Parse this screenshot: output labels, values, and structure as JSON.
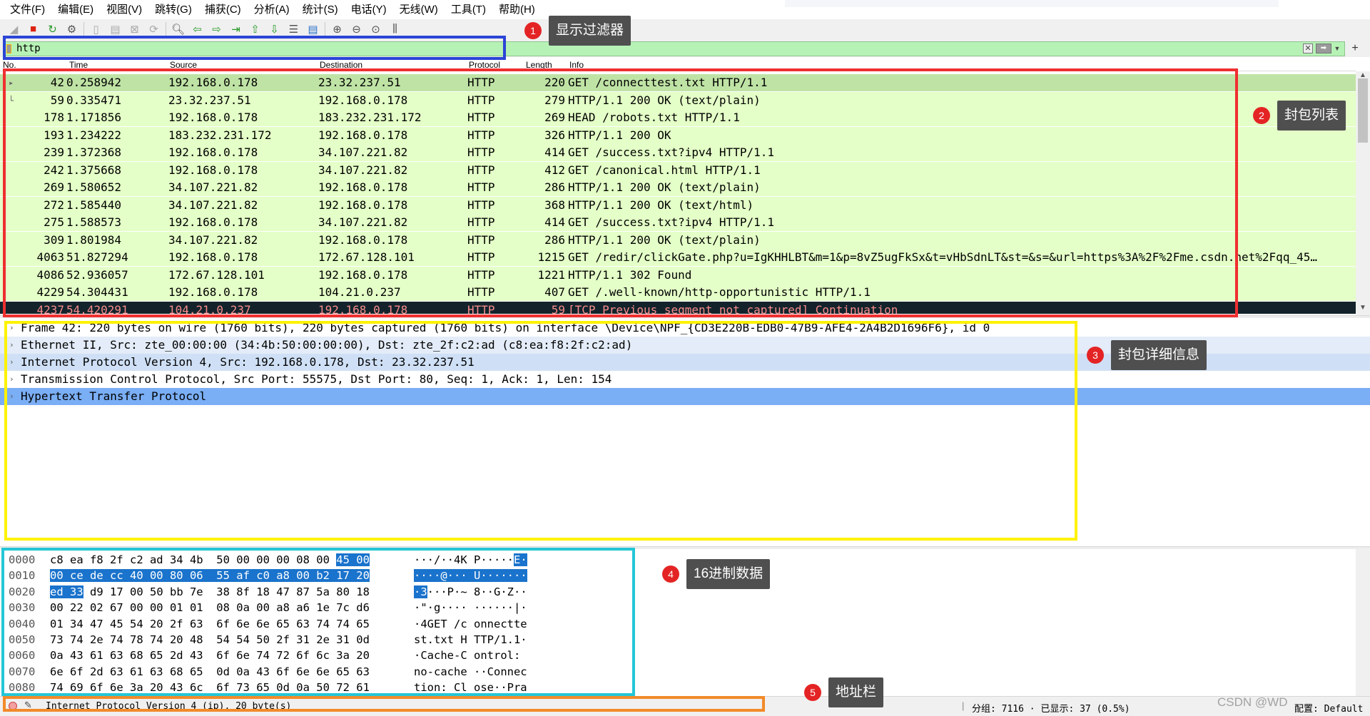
{
  "menu": [
    "文件(F)",
    "编辑(E)",
    "视图(V)",
    "跳转(G)",
    "捕获(C)",
    "分析(A)",
    "统计(S)",
    "电话(Y)",
    "无线(W)",
    "工具(T)",
    "帮助(H)"
  ],
  "filter": {
    "value": "http"
  },
  "packet_list": {
    "columns": [
      "No.",
      "Time",
      "Source",
      "Destination",
      "Protocol",
      "Length",
      "Info"
    ],
    "rows": [
      {
        "no": "42",
        "time": "0.258942",
        "src": "192.168.0.178",
        "dst": "23.32.237.51",
        "proto": "HTTP",
        "len": "220",
        "info": "GET /connecttest.txt HTTP/1.1"
      },
      {
        "no": "59",
        "time": "0.335471",
        "src": "23.32.237.51",
        "dst": "192.168.0.178",
        "proto": "HTTP",
        "len": "279",
        "info": "HTTP/1.1 200 OK  (text/plain)"
      },
      {
        "no": "178",
        "time": "1.171856",
        "src": "192.168.0.178",
        "dst": "183.232.231.172",
        "proto": "HTTP",
        "len": "269",
        "info": "HEAD /robots.txt HTTP/1.1"
      },
      {
        "no": "193",
        "time": "1.234222",
        "src": "183.232.231.172",
        "dst": "192.168.0.178",
        "proto": "HTTP",
        "len": "326",
        "info": "HTTP/1.1 200 OK"
      },
      {
        "no": "239",
        "time": "1.372368",
        "src": "192.168.0.178",
        "dst": "34.107.221.82",
        "proto": "HTTP",
        "len": "414",
        "info": "GET /success.txt?ipv4 HTTP/1.1"
      },
      {
        "no": "242",
        "time": "1.375668",
        "src": "192.168.0.178",
        "dst": "34.107.221.82",
        "proto": "HTTP",
        "len": "412",
        "info": "GET /canonical.html HTTP/1.1"
      },
      {
        "no": "269",
        "time": "1.580652",
        "src": "34.107.221.82",
        "dst": "192.168.0.178",
        "proto": "HTTP",
        "len": "286",
        "info": "HTTP/1.1 200 OK  (text/plain)"
      },
      {
        "no": "272",
        "time": "1.585440",
        "src": "34.107.221.82",
        "dst": "192.168.0.178",
        "proto": "HTTP",
        "len": "368",
        "info": "HTTP/1.1 200 OK  (text/html)"
      },
      {
        "no": "275",
        "time": "1.588573",
        "src": "192.168.0.178",
        "dst": "34.107.221.82",
        "proto": "HTTP",
        "len": "414",
        "info": "GET /success.txt?ipv4 HTTP/1.1"
      },
      {
        "no": "309",
        "time": "1.801984",
        "src": "34.107.221.82",
        "dst": "192.168.0.178",
        "proto": "HTTP",
        "len": "286",
        "info": "HTTP/1.1 200 OK  (text/plain)"
      },
      {
        "no": "4063",
        "time": "51.827294",
        "src": "192.168.0.178",
        "dst": "172.67.128.101",
        "proto": "HTTP",
        "len": "1215",
        "info": "GET /redir/clickGate.php?u=IgKHHLBT&m=1&p=8vZ5ugFkSx&t=vHbSdnLT&st=&s=&url=https%3A%2F%2Fme.csdn.net%2Fqq_45…"
      },
      {
        "no": "4086",
        "time": "52.936057",
        "src": "172.67.128.101",
        "dst": "192.168.0.178",
        "proto": "HTTP",
        "len": "1221",
        "info": "HTTP/1.1 302 Found"
      },
      {
        "no": "4229",
        "time": "54.304431",
        "src": "192.168.0.178",
        "dst": "104.21.0.237",
        "proto": "HTTP",
        "len": "407",
        "info": "GET /.well-known/http-opportunistic HTTP/1.1"
      },
      {
        "no": "4237",
        "time": "54.420291",
        "src": "104.21.0.237",
        "dst": "192.168.0.178",
        "proto": "HTTP",
        "len": "59",
        "info": "[TCP Previous segment not captured] Continuation"
      }
    ]
  },
  "details": [
    "Frame 42: 220 bytes on wire (1760 bits), 220 bytes captured (1760 bits) on interface \\Device\\NPF_{CD3E220B-EDB0-47B9-AFE4-2A4B2D1696F6}, id 0",
    "Ethernet II, Src: zte_00:00:00 (34:4b:50:00:00:00), Dst: zte_2f:c2:ad (c8:ea:f8:2f:c2:ad)",
    "Internet Protocol Version 4, Src: 192.168.0.178, Dst: 23.32.237.51",
    "Transmission Control Protocol, Src Port: 55575, Dst Port: 80, Seq: 1, Ack: 1, Len: 154",
    "Hypertext Transfer Protocol"
  ],
  "hex": [
    {
      "off": "0000",
      "hex_a": "c8 ea f8 2f c2 ad 34 4b  50 00 00 00 08 00 ",
      "hex_b": "45 00",
      "hex_c": "",
      "asc_a": "···/··4K P·····",
      "asc_b": "E·",
      "asc_c": ""
    },
    {
      "off": "0010",
      "hex_a": "",
      "hex_b": "00 ce de cc 40 00 80 06  55 af c0 a8 00 b2 17 20",
      "hex_c": "",
      "asc_a": "",
      "asc_b": "····@··· U·······",
      "asc_c": ""
    },
    {
      "off": "0020",
      "hex_a": "",
      "hex_b": "ed 33",
      "hex_c": " d9 17 00 50 bb 7e  38 8f 18 47 87 5a 80 18",
      "asc_a": "",
      "asc_b": "·3",
      "asc_c": "···P·~ 8··G·Z··"
    },
    {
      "off": "0030",
      "hex_a": "00 22 02 67 00 00 01 01  08 0a 00 a8 a6 1e 7c d6",
      "hex_b": "",
      "hex_c": "",
      "asc_a": "·\"·g···· ······|·",
      "asc_b": "",
      "asc_c": ""
    },
    {
      "off": "0040",
      "hex_a": "01 34 47 45 54 20 2f 63  6f 6e 6e 65 63 74 74 65",
      "hex_b": "",
      "hex_c": "",
      "asc_a": "·4GET /c onnectte",
      "asc_b": "",
      "asc_c": ""
    },
    {
      "off": "0050",
      "hex_a": "73 74 2e 74 78 74 20 48  54 54 50 2f 31 2e 31 0d",
      "hex_b": "",
      "hex_c": "",
      "asc_a": "st.txt H TTP/1.1·",
      "asc_b": "",
      "asc_c": ""
    },
    {
      "off": "0060",
      "hex_a": "0a 43 61 63 68 65 2d 43  6f 6e 74 72 6f 6c 3a 20",
      "hex_b": "",
      "hex_c": "",
      "asc_a": "·Cache-C ontrol: ",
      "asc_b": "",
      "asc_c": ""
    },
    {
      "off": "0070",
      "hex_a": "6e 6f 2d 63 61 63 68 65  0d 0a 43 6f 6e 6e 65 63",
      "hex_b": "",
      "hex_c": "",
      "asc_a": "no-cache ··Connec",
      "asc_b": "",
      "asc_c": ""
    },
    {
      "off": "0080",
      "hex_a": "74 69 6f 6e 3a 20 43 6c  6f 73 65 0d 0a 50 72 61",
      "hex_b": "",
      "hex_c": "",
      "asc_a": "tion: Cl ose··Pra",
      "asc_b": "",
      "asc_c": ""
    }
  ],
  "status": {
    "text": "Internet Protocol Version 4 (ip), 20 byte(s)",
    "packets": "分组: 7116 · 已显示: 37 (0.5%)",
    "profile": "配置: Default"
  },
  "annotations": [
    {
      "num": "1",
      "label": "显示过滤器"
    },
    {
      "num": "2",
      "label": "封包列表"
    },
    {
      "num": "3",
      "label": "封包详细信息"
    },
    {
      "num": "4",
      "label": "16进制数据"
    },
    {
      "num": "5",
      "label": "地址栏"
    }
  ],
  "watermark": "CSDN @WD",
  "colors": {
    "http_row": "#e4ffc7",
    "tcp_row": "#14232b",
    "tcp_text": "#f78c8c",
    "filter_ok": "#b6f2b5",
    "selected": "#7aaef5"
  }
}
